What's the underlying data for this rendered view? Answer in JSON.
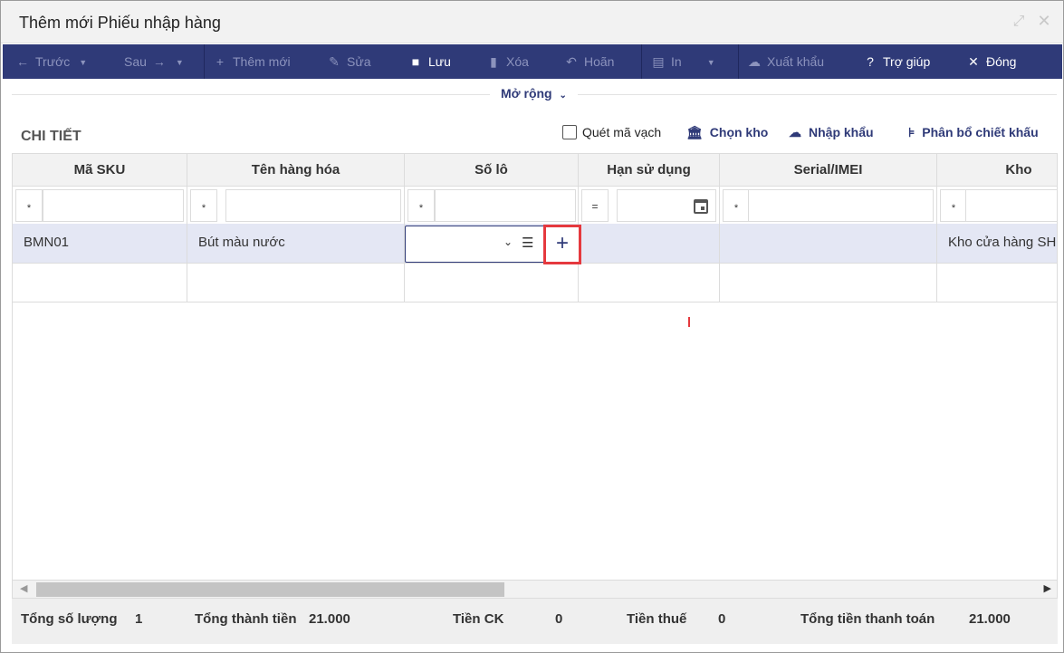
{
  "window": {
    "title": "Thêm mới Phiếu nhập hàng"
  },
  "toolbar": {
    "prev_label": "Trước",
    "next_label": "Sau",
    "add_label": "Thêm mới",
    "edit_label": "Sửa",
    "save_label": "Lưu",
    "delete_label": "Xóa",
    "undo_label": "Hoãn",
    "print_label": "In",
    "export_label": "Xuất khẩu",
    "help_label": "Trợ giúp",
    "close_label": "Đóng"
  },
  "expand": {
    "label": "Mở rộng"
  },
  "section": {
    "title": "CHI TIẾT",
    "scan_barcode_label": "Quét mã vạch",
    "choose_warehouse_label": "Chọn kho",
    "import_label": "Nhập khẩu",
    "discount_allocation_label": "Phân bổ chiết khấu"
  },
  "grid": {
    "columns": [
      "Mã SKU",
      "Tên hàng hóa",
      "Số lô",
      "Hạn sử dụng",
      "Serial/IMEI",
      "Kho"
    ],
    "filter_ops": [
      "*",
      "*",
      "*",
      "=",
      "*",
      "*"
    ],
    "rows": [
      {
        "sku": "BMN01",
        "name": "Bút màu nước",
        "lot": "",
        "expiry": "",
        "serial": "",
        "warehouse": "Kho cửa hàng SH"
      }
    ]
  },
  "totals": {
    "qty_label": "Tổng số lượng",
    "qty_value": "1",
    "amount_label": "Tổng thành tiền",
    "amount_value": "21.000",
    "discount_label": "Tiền CK",
    "discount_value": "0",
    "tax_label": "Tiền thuế",
    "tax_value": "0",
    "payment_label": "Tổng tiền thanh toán",
    "payment_value": "21.000"
  },
  "colors": {
    "toolbar_bg": "#2f3a78",
    "row_highlight": "#e4e7f4",
    "highlight_box": "#e5393e"
  }
}
